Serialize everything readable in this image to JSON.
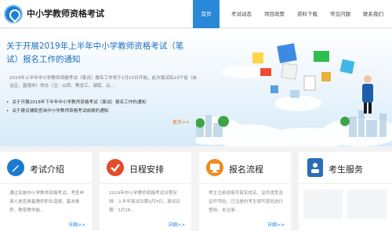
{
  "site": {
    "title": "中小学教师资格考试"
  },
  "nav": {
    "items": [
      "首页",
      "考试动态",
      "项目政策",
      "资料下载",
      "常见问题",
      "联系我们"
    ],
    "active": 0
  },
  "banner": {
    "headline": "关于开展2019年上半年中小学教师资格考试（笔试）报名工作的通知",
    "summary": "2019年上半年中小学教师资格考试（笔试）报名工作将于1月15日开始，此次笔试有23个省（自治区、直辖市）举办（注：山西、黑龙江、湖南、云...",
    "news": [
      "关于开展2018年下半年中小学教师资格考试（面试）报名工作的通知",
      "关于建议辅助查询中小学教师资格考试成绩的通知"
    ],
    "more_label": "更多>>"
  },
  "cards": [
    {
      "title": "考试介绍",
      "icon": "pen-icon",
      "desc": "通过实施中小学教师资格考试，考查申请人是否具备教师职业道德、基本素养、教育教学能...",
      "more": "详细>>"
    },
    {
      "title": "日程安排",
      "icon": "checkmark-icon",
      "desc": "2019年中小学教师资格考试日程安排：上半年笔试日期3月9日，面试日期：5月18...",
      "more": "详细>>"
    },
    {
      "title": "报名流程",
      "icon": "computer-icon",
      "desc": "考生注册须填写真实姓名，证件类型及证件号码，已注册的考生填写密码进行登陆，未注册...",
      "more": "详细>>"
    },
    {
      "title": "考生服务",
      "icon": "id-card-icon"
    }
  ]
}
